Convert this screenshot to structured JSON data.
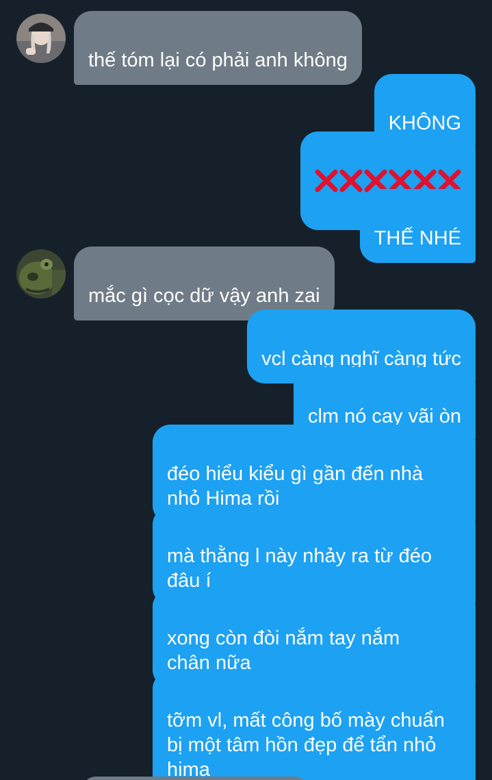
{
  "conversation": {
    "messages": [
      {
        "id": "m1",
        "side": "received",
        "text": "thế tóm lại có phải anh không"
      },
      {
        "id": "m2",
        "side": "sent",
        "text": "KHÔNG"
      },
      {
        "id": "m3",
        "side": "sent",
        "emoji": "cross-mark-icon",
        "emoji_count": 6
      },
      {
        "id": "m4",
        "side": "sent",
        "text": "THẾ NHÉ"
      },
      {
        "id": "m5",
        "side": "received",
        "text": "mắc gì cọc dữ vậy anh zai"
      },
      {
        "id": "m6",
        "side": "sent",
        "text": "vcl càng nghĩ càng tức"
      },
      {
        "id": "m7",
        "side": "sent",
        "text": "clm nó cay vãi òn"
      },
      {
        "id": "m8",
        "side": "sent",
        "text": "đéo hiểu kiểu gì gần đến nhà\nnhỏ Hima rồi"
      },
      {
        "id": "m9",
        "side": "sent",
        "text": "mà thằng l này nhảy ra từ đéo\nđâu í"
      },
      {
        "id": "m10",
        "side": "sent",
        "text": "xong còn đòi nắm tay nắm\nchân nữa"
      },
      {
        "id": "m11",
        "side": "sent",
        "text": "tỡm vl, mất công bố mày chuẩn\nbị một tâm hồn đẹp để tẩn nhỏ\nhima"
      }
    ]
  },
  "colors": {
    "background": "#16202a",
    "received_bubble": "#6f7b86",
    "sent_bubble": "#1da1f2",
    "cross_mark": "#e0102f"
  }
}
